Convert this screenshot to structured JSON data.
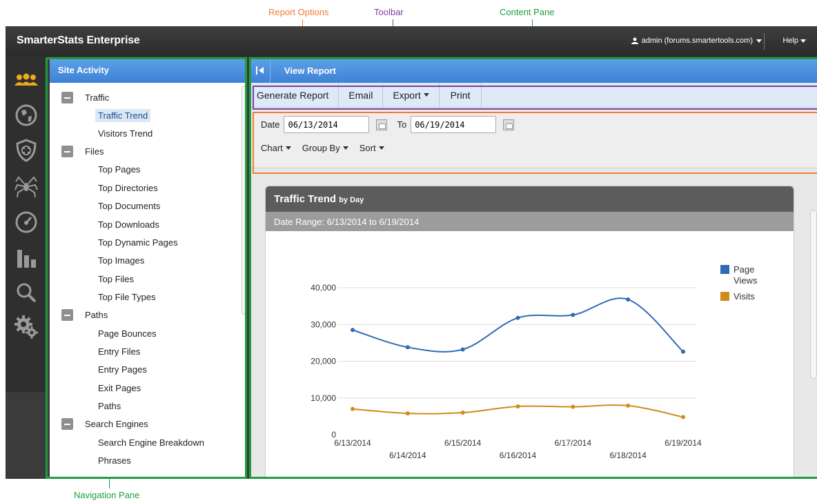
{
  "callouts": {
    "report_options": "Report Options",
    "toolbar": "Toolbar",
    "content_pane": "Content Pane",
    "navigation_pane": "Navigation Pane"
  },
  "app": {
    "title": "SmarterStats Enterprise",
    "user": "admin (forums.smartertools.com)",
    "help": "Help"
  },
  "rail": [
    "users-icon",
    "globe-icon",
    "shield-icon",
    "spider-icon",
    "speedometer-icon",
    "bar-chart-icon",
    "search-icon",
    "gear-icon"
  ],
  "nav": {
    "title": "Site Activity",
    "groups": [
      {
        "label": "Traffic",
        "items": [
          "Traffic Trend",
          "Visitors Trend"
        ]
      },
      {
        "label": "Files",
        "items": [
          "Top Pages",
          "Top Directories",
          "Top Documents",
          "Top Downloads",
          "Top Dynamic Pages",
          "Top Images",
          "Top Files",
          "Top File Types"
        ]
      },
      {
        "label": "Paths",
        "items": [
          "Page Bounces",
          "Entry Files",
          "Entry Pages",
          "Exit Pages",
          "Paths"
        ]
      },
      {
        "label": "Search Engines",
        "items": [
          "Search Engine Breakdown",
          "Phrases"
        ]
      }
    ],
    "active_item": "Traffic Trend"
  },
  "content": {
    "header": "View Report",
    "toolbar": [
      "Generate Report",
      "Email",
      "Export",
      "Print"
    ],
    "options": {
      "date_label": "Date",
      "date_value": "06/13/2014",
      "to_label": "To",
      "to_value": "06/19/2014",
      "chart": "Chart",
      "group_by": "Group By",
      "sort": "Sort"
    },
    "report": {
      "title": "Traffic Trend",
      "subtitle": "by Day",
      "range": "Date Range: 6/13/2014 to 6/19/2014"
    }
  },
  "colors": {
    "page_views": "#2e6bb5",
    "visits": "#d08a1a",
    "highlight_green": "#1e9e3e",
    "highlight_orange": "#f07c32",
    "highlight_purple": "#7d3ca0"
  },
  "chart_data": {
    "type": "line",
    "x": [
      "6/13/2014",
      "6/14/2014",
      "6/15/2014",
      "6/16/2014",
      "6/17/2014",
      "6/18/2014",
      "6/19/2014"
    ],
    "series": [
      {
        "name": "Page Views",
        "values": [
          28500,
          23800,
          23200,
          31800,
          32600,
          36800,
          22600
        ]
      },
      {
        "name": "Visits",
        "values": [
          7000,
          5800,
          6000,
          7700,
          7600,
          7900,
          4800
        ]
      }
    ],
    "y_ticks": [
      "0",
      "10,000",
      "20,000",
      "30,000",
      "40,000"
    ],
    "ylim": [
      0,
      40000
    ],
    "legend": "right",
    "grid": "horizontal"
  }
}
